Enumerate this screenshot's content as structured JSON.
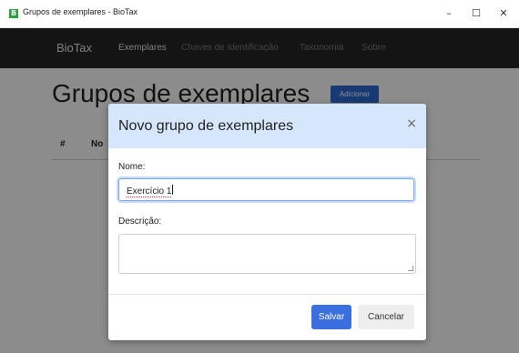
{
  "window": {
    "app_icon_letter": "B",
    "title": "Grupos de exemplares - BioTax",
    "controls": {
      "minimize": "–",
      "maximize": "☐",
      "close": "✕"
    }
  },
  "navbar": {
    "brand": "BioTax",
    "items": [
      {
        "label": "Exemplares",
        "active": true
      },
      {
        "label": "Chaves de Identificação",
        "active": false
      },
      {
        "label": "Taxonomia",
        "active": false
      },
      {
        "label": "Sobre",
        "active": false
      }
    ]
  },
  "page": {
    "title": "Grupos de exemplares",
    "add_button": "Adicionar",
    "table_headers": [
      "#",
      "No"
    ]
  },
  "modal": {
    "title": "Novo grupo de exemplares",
    "close_glyph": "×",
    "name_label": "Nome:",
    "name_value": "Exercício 1",
    "description_label": "Descrição:",
    "description_value": "",
    "save_button": "Salvar",
    "cancel_button": "Cancelar"
  },
  "colors": {
    "navbar": "#262626",
    "primary": "#2a6ad6",
    "modal_header": "#d6e7fb"
  }
}
